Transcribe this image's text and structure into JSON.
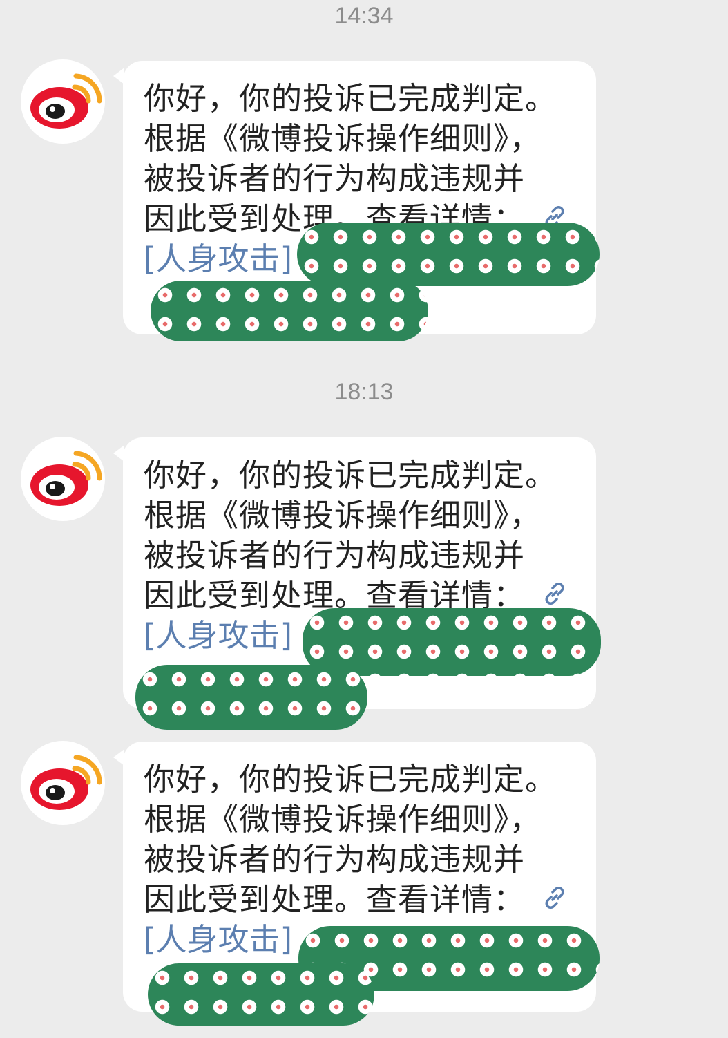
{
  "messages": [
    {
      "timestamp": "14:34",
      "lines": [
        "你好，你的投诉已完成判定。",
        "根据《微博投诉操作细则》，",
        "被投诉者的行为构成违规并",
        "因此受到处理。查看详情："
      ],
      "link_label": "[人身攻击]",
      "link_icon": "link-icon"
    },
    {
      "timestamp": "18:13",
      "lines": [
        "你好，你的投诉已完成判定。",
        "根据《微博投诉操作细则》，",
        "被投诉者的行为构成违规并",
        "因此受到处理。查看详情："
      ],
      "link_label": "[人身攻击]",
      "link_icon": "link-icon"
    },
    {
      "timestamp": "",
      "lines": [
        "你好，你的投诉已完成判定。",
        "根据《微博投诉操作细则》，",
        "被投诉者的行为构成违规并",
        "因此受到处理。查看详情："
      ],
      "link_label": "[人身攻击]",
      "link_icon": "link-icon"
    }
  ],
  "sender": {
    "avatar_icon": "weibo-logo-icon"
  },
  "colors": {
    "background": "#ececec",
    "bubble": "#ffffff",
    "text": "#222222",
    "link": "#5c7fb0",
    "timestamp": "#8c8c8c",
    "redaction": "#2d8659",
    "weibo_red": "#e6162d",
    "weibo_orange": "#f5a623"
  }
}
